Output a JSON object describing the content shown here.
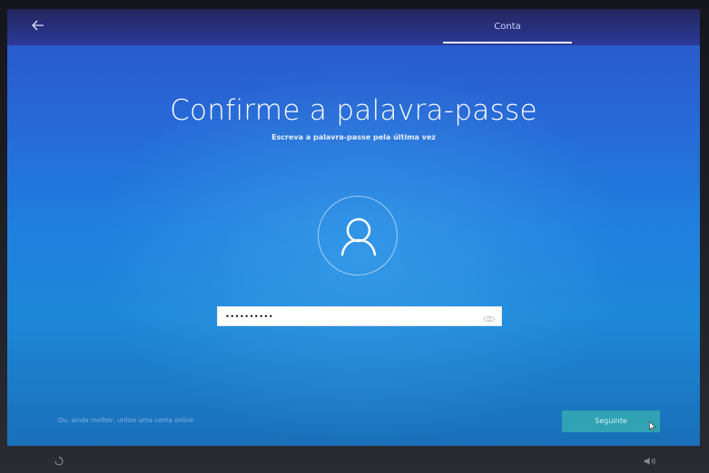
{
  "header": {
    "step_label": "Conta"
  },
  "main": {
    "title": "Confirme a palavra-passe",
    "subtitle": "Escreva a palavra-passe pela última vez",
    "password_value": "••••••••••"
  },
  "footer": {
    "online_account_link": "Ou, ainda melhor, utilize uma conta online",
    "next_label": "Seguinte"
  },
  "icons": {
    "back": "back-arrow-icon",
    "avatar": "user-icon",
    "reveal": "eye-icon",
    "ease_of_access": "ease-of-access-icon",
    "volume": "volume-icon"
  },
  "colors": {
    "next_button": "#2fa2b4",
    "link": "#7fb4e6"
  }
}
